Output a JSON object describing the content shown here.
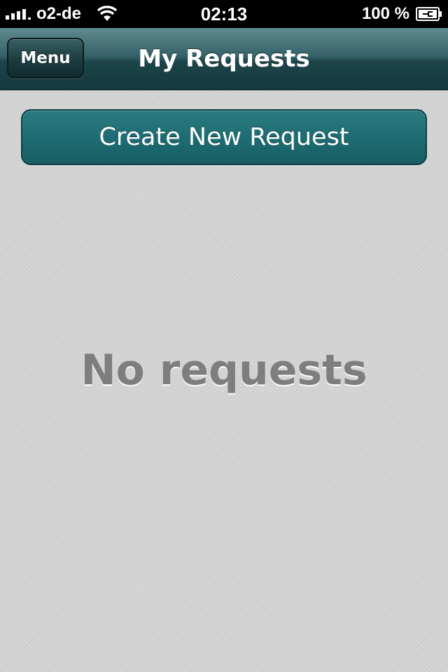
{
  "status_bar": {
    "carrier": "o2-de",
    "time": "02:13",
    "battery_percent": "100 %",
    "signal_icon": "signal-bars-icon",
    "wifi_icon": "wifi-icon",
    "battery_icon": "battery-charging-icon"
  },
  "nav_bar": {
    "menu_label": "Menu",
    "title": "My Requests"
  },
  "content": {
    "create_button_label": "Create New Request",
    "empty_message": "No requests"
  },
  "colors": {
    "nav_bar": "#1c4449",
    "primary_button": "#1e6c72",
    "background": "#d3d3d3",
    "empty_text": "#7e7e7e"
  }
}
